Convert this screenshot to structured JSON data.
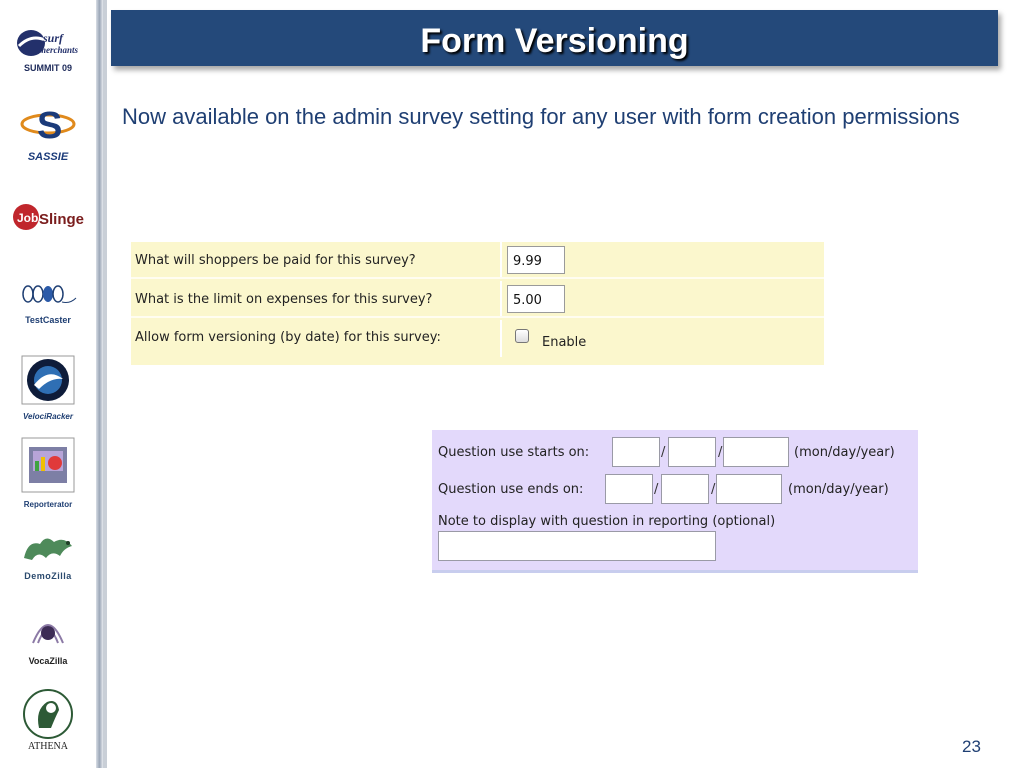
{
  "slide": {
    "title": "Form Versioning",
    "intro": "Now available on the admin survey setting for any user with form creation permissions",
    "page_number": "23"
  },
  "sidebar": {
    "logos": [
      {
        "name": "Surf Merchants",
        "caption": "SUMMIT 09"
      },
      {
        "name": "SASSIE",
        "caption": "SASSIE"
      },
      {
        "name": "JobSlinger",
        "caption": "JobSlinger"
      },
      {
        "name": "TestCaster",
        "caption": "TestCaster"
      },
      {
        "name": "VelociRacker",
        "caption": "VelociRacker"
      },
      {
        "name": "Reporterator",
        "caption": "Reporterator"
      },
      {
        "name": "DemoZilla",
        "caption": "DemoZilla"
      },
      {
        "name": "VocaZilla",
        "caption": "VocaZilla"
      },
      {
        "name": "Athena",
        "caption": "ATHENA"
      }
    ]
  },
  "survey_settings": {
    "rows": [
      {
        "label": "What will shoppers be paid for this survey?",
        "value": "9.99"
      },
      {
        "label": "What is the limit on expenses for this survey?",
        "value": "5.00"
      },
      {
        "label": "Allow form versioning (by date) for this survey:",
        "checkbox_label": "Enable",
        "checked": false
      }
    ]
  },
  "versioning_panel": {
    "starts_label": "Question use starts on:",
    "ends_label": "Question use ends on:",
    "date_format": "(mon/day/year)",
    "slash": "/",
    "note_label": "Note to display with question in reporting (optional)"
  },
  "colors": {
    "title_bar": "#24497a",
    "intro_text": "#1f3f73",
    "yellow_panel": "#fbf7cd",
    "purple_panel": "#e3d9fb"
  }
}
